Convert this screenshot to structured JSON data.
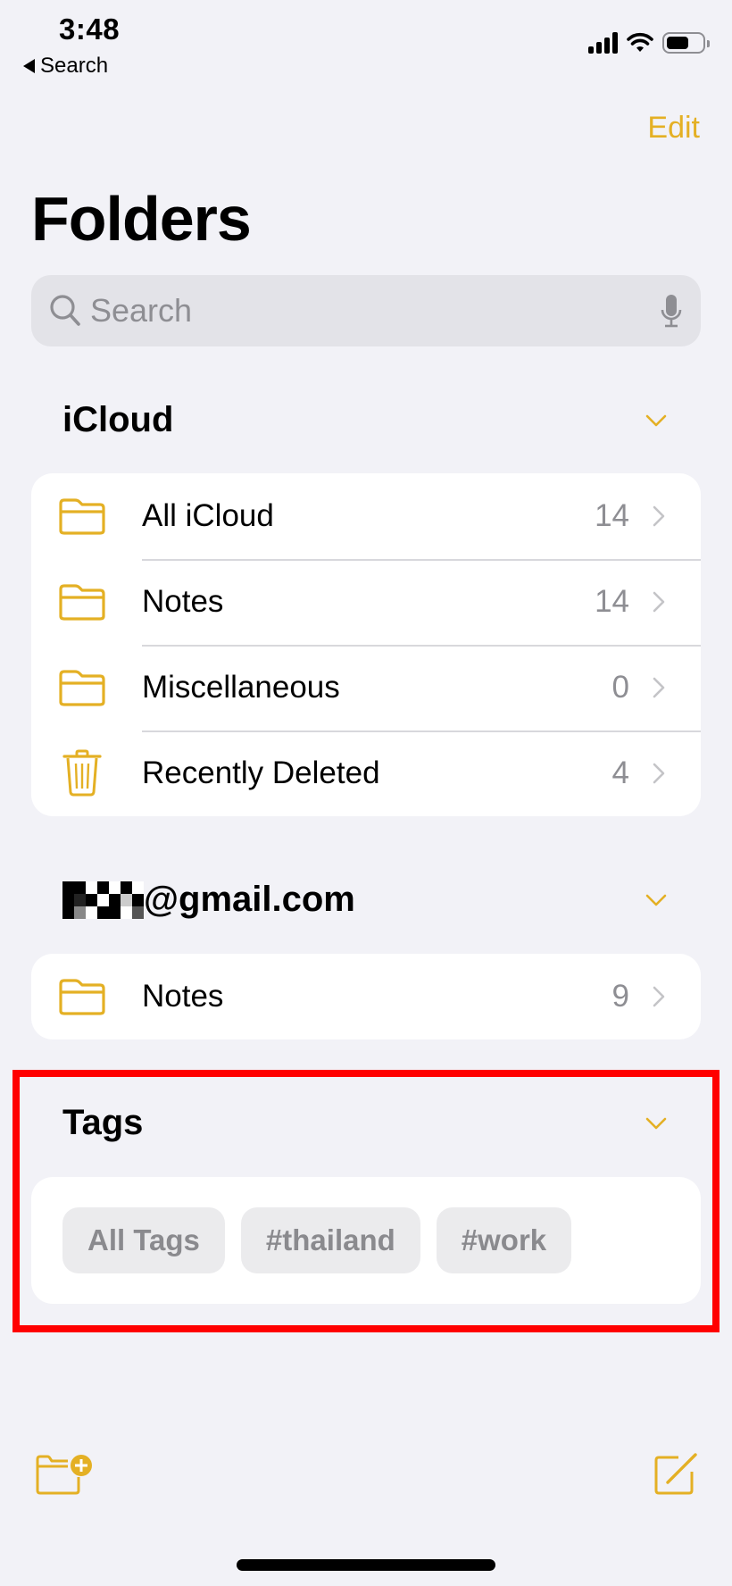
{
  "status_bar": {
    "time": "3:48",
    "back_label": "Search",
    "signal_bars": 4,
    "battery_level_percent": 62
  },
  "header": {
    "edit_label": "Edit",
    "title": "Folders"
  },
  "search": {
    "placeholder": "Search",
    "value": ""
  },
  "colors": {
    "accent": "#e4b024",
    "background": "#f2f2f7",
    "secondary_text": "#8e8e93",
    "highlight_frame": "#ff0000"
  },
  "sections": [
    {
      "title": "iCloud",
      "expanded": true,
      "items": [
        {
          "label": "All iCloud",
          "count": "14",
          "icon": "folder-icon"
        },
        {
          "label": "Notes",
          "count": "14",
          "icon": "folder-icon"
        },
        {
          "label": "Miscellaneous",
          "count": "0",
          "icon": "folder-icon"
        },
        {
          "label": "Recently Deleted",
          "count": "4",
          "icon": "trash-icon"
        }
      ]
    },
    {
      "title": "@gmail.com",
      "title_redacted_prefix": true,
      "expanded": true,
      "items": [
        {
          "label": "Notes",
          "count": "9",
          "icon": "folder-icon"
        }
      ]
    }
  ],
  "tags": {
    "title": "Tags",
    "expanded": true,
    "chips": [
      "All Tags",
      "#thailand",
      "#work"
    ]
  },
  "toolbar": {
    "new_folder_icon": "folder-plus-icon",
    "compose_icon": "compose-icon"
  }
}
